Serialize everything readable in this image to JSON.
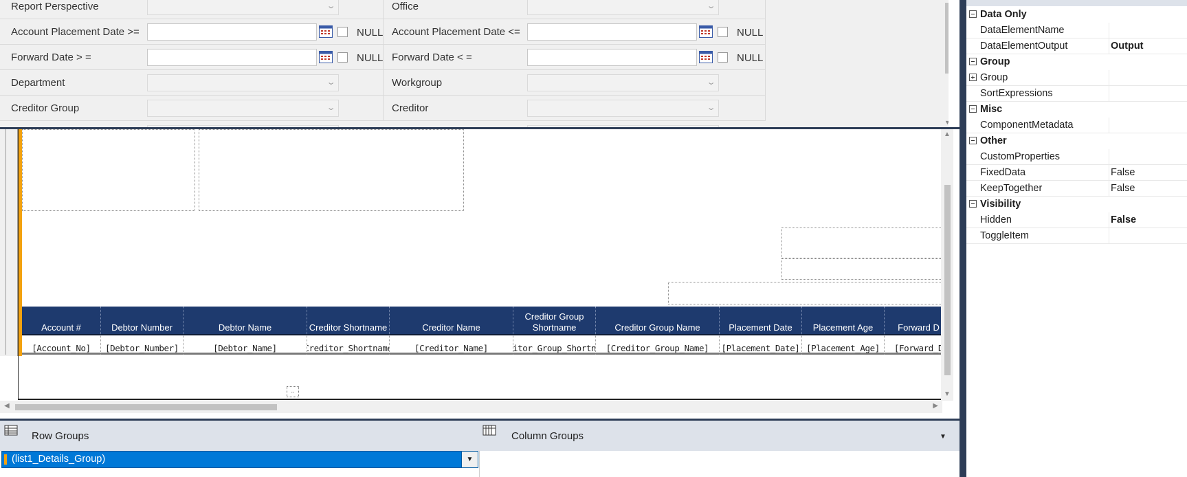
{
  "parameters": {
    "rows": [
      {
        "left": {
          "label": "Report Perspective",
          "type": "combo"
        },
        "right": {
          "label": "Office",
          "type": "combo"
        }
      },
      {
        "left": {
          "label": "Account Placement Date >=",
          "type": "date",
          "null_label": "NULL"
        },
        "right": {
          "label": "Account Placement Date <=",
          "type": "date",
          "null_label": "NULL"
        }
      },
      {
        "left": {
          "label": "Forward Date > =",
          "type": "date",
          "null_label": "NULL"
        },
        "right": {
          "label": "Forward Date < =",
          "type": "date",
          "null_label": "NULL"
        }
      },
      {
        "left": {
          "label": "Department",
          "type": "combo"
        },
        "right": {
          "label": "Workgroup",
          "type": "combo"
        }
      },
      {
        "left": {
          "label": "Creditor Group",
          "type": "combo"
        },
        "right": {
          "label": "Creditor",
          "type": "combo"
        }
      }
    ]
  },
  "tablix": {
    "headers": [
      "Account #",
      "Debtor Number",
      "Debtor Name",
      "Creditor Shortname",
      "Creditor Name",
      "Creditor Group Shortname",
      "Creditor Group Name",
      "Placement Date",
      "Placement Age",
      "Forward D"
    ],
    "cells": [
      "[Account_No]",
      "[Debtor_Number]",
      "[Debtor_Name]",
      "Creditor_Shortname",
      "[Creditor_Name]",
      "ditor_Group_Shortna",
      "[Creditor_Group_Name]",
      "[Placement_Date]",
      "[Placement_Age]",
      "[Forward_D"
    ],
    "header_color": "#1e3a6e"
  },
  "canvas": {
    "marker_text": ".."
  },
  "groups": {
    "row_groups_title": "Row Groups",
    "column_groups_title": "Column Groups",
    "row_group_item": "(list1_Details_Group)",
    "selection_color": "#0078d7"
  },
  "properties": {
    "items": [
      {
        "kind": "category",
        "name": "Data Only"
      },
      {
        "kind": "prop",
        "name": "DataElementName",
        "value": ""
      },
      {
        "kind": "prop",
        "name": "DataElementOutput",
        "value": "Output",
        "bold": true
      },
      {
        "kind": "category",
        "name": "Group"
      },
      {
        "kind": "prop",
        "name": "Group",
        "value": "",
        "expandable": true
      },
      {
        "kind": "prop",
        "name": "SortExpressions",
        "value": ""
      },
      {
        "kind": "category",
        "name": "Misc"
      },
      {
        "kind": "prop",
        "name": "ComponentMetadata",
        "value": ""
      },
      {
        "kind": "category",
        "name": "Other"
      },
      {
        "kind": "prop",
        "name": "CustomProperties",
        "value": ""
      },
      {
        "kind": "prop",
        "name": "FixedData",
        "value": "False"
      },
      {
        "kind": "prop",
        "name": "KeepTogether",
        "value": "False"
      },
      {
        "kind": "category",
        "name": "Visibility"
      },
      {
        "kind": "prop",
        "name": "Hidden",
        "value": "False",
        "bold": true
      },
      {
        "kind": "prop",
        "name": "ToggleItem",
        "value": ""
      }
    ]
  },
  "icons": {
    "calendar": "calendar-icon",
    "chevron": "chevron-down-icon",
    "row_groups": "row-groups-icon",
    "column_groups": "column-groups-icon"
  }
}
